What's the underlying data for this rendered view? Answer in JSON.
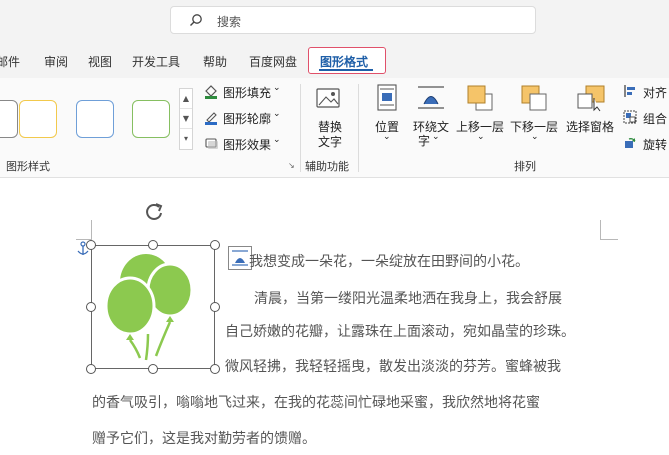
{
  "search": {
    "placeholder": "搜索",
    "icon": "search-icon"
  },
  "tabs": [
    {
      "label": "邮件"
    },
    {
      "label": "审阅"
    },
    {
      "label": "视图"
    },
    {
      "label": "开发工具"
    },
    {
      "label": "帮助"
    },
    {
      "label": "百度网盘"
    },
    {
      "label": "图形格式"
    }
  ],
  "active_tab": "图形格式",
  "colors": {
    "accent": "#1f5fa8",
    "highlight_border": "#e0506a",
    "balloon_green": "#8cc94f"
  },
  "ribbon": {
    "shape_styles": {
      "fill": "图形填充",
      "outline": "图形轮廓",
      "effects": "图形效果",
      "group_label": "图形样式"
    },
    "accessibility": {
      "alt_text_line1": "替换",
      "alt_text_line2": "文字",
      "group_label": "辅助功能"
    },
    "arrange": {
      "position": "位置",
      "wrap_line1": "环绕文",
      "wrap_line2": "字",
      "bring_forward": "上移一层",
      "send_backward": "下移一层",
      "selection_pane": "选择窗格",
      "align": "对齐",
      "group": "组合",
      "rotate": "旋转",
      "group_label": "排列"
    }
  },
  "document": {
    "lines": [
      "我想变成一朵花，一朵绽放在田野间的小花。",
      "清晨，当第一缕阳光温柔地洒在我身上，我会舒展",
      "自己娇嫩的花瓣，让露珠在上面滚动，宛如晶莹的珍珠。",
      "微风轻拂，我轻轻摇曳，散发出淡淡的芬芳。蜜蜂被我",
      "的香气吸引，嗡嗡地飞过来，在我的花蕊间忙碌地采蜜，我欣然地将花蜜",
      "赠予它们，这是我对勤劳者的馈赠。"
    ]
  }
}
